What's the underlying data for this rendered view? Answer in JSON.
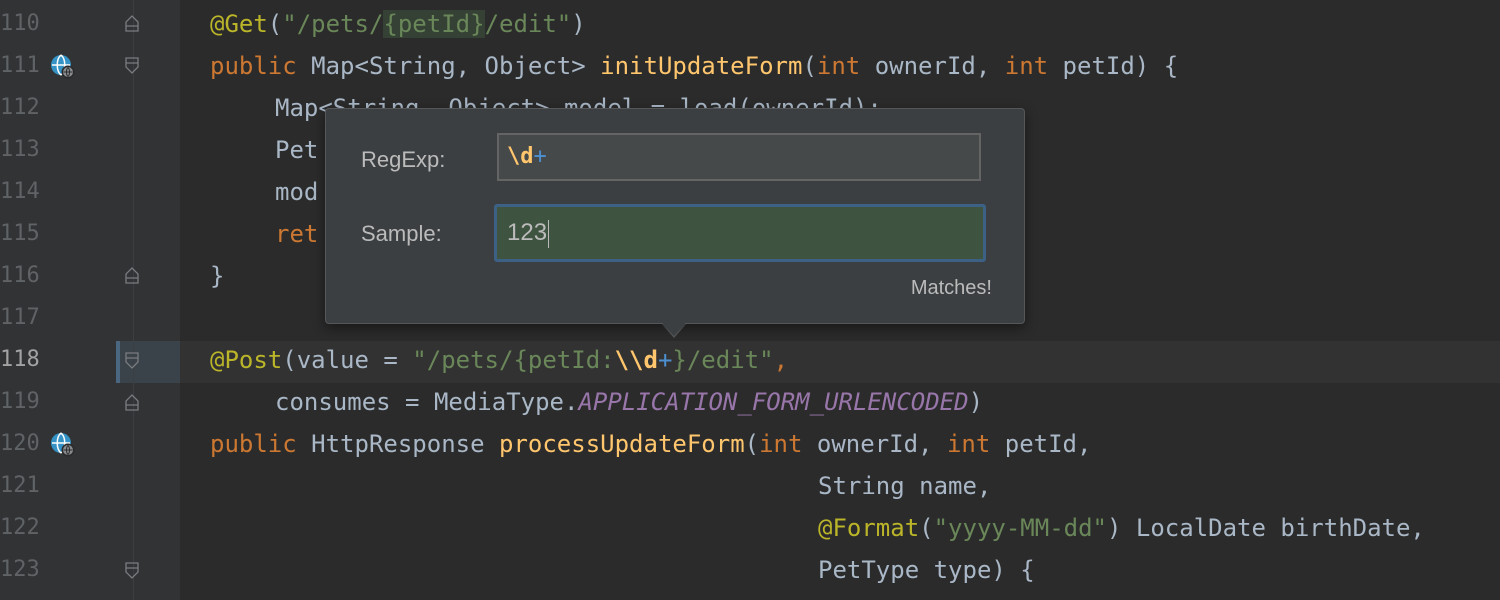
{
  "gutter": {
    "line_numbers": [
      "110",
      "111",
      "112",
      "113",
      "114",
      "115",
      "116",
      "117",
      "118",
      "119",
      "120",
      "121",
      "122",
      "123"
    ],
    "current_line": "118"
  },
  "icons": {
    "fold_marker": "fold-marker-icon",
    "implementation": "globe-implementation-icon"
  },
  "code": {
    "l110": {
      "at": "@Get",
      "p1": "(",
      "s1": "\"/pets/",
      "s2": "{petId}",
      "s3": "/edit\"",
      "p2": ")"
    },
    "l111": {
      "kw1": "public",
      "t1": " Map<String, Object> ",
      "fn": "initUpdateForm",
      "p1": "(",
      "kw2": "int",
      "t2": " ownerId, ",
      "kw3": "int",
      "t3": " petId) {"
    },
    "l112": {
      "t": "Map<String, Object> model = load(ownerId);"
    },
    "l113": {
      "t": "Pet"
    },
    "l114": {
      "t": "mod"
    },
    "l115": {
      "kw": "ret"
    },
    "l116": {
      "t": "}"
    },
    "l118": {
      "at": "@Post",
      "t1": "(value = ",
      "s1": "\"/pets/{petId:",
      "rx1": "\\\\d",
      "rx2": "+",
      "s2": "}/edit\"",
      "t2": ","
    },
    "l119": {
      "t1": "consumes = MediaType.",
      "c": "APPLICATION_FORM_URLENCODED",
      "t2": ")"
    },
    "l120": {
      "kw1": "public",
      "t1": " HttpResponse ",
      "fn": "processUpdateForm",
      "p1": "(",
      "kw2": "int",
      "t2": " ownerId, ",
      "kw3": "int",
      "t3": " petId,"
    },
    "l121": {
      "t": "String name,"
    },
    "l122": {
      "at": "@Format",
      "p1": "(",
      "s": "\"yyyy-MM-dd\"",
      "t": ") LocalDate birthDate,"
    },
    "l123": {
      "t": "PetType type) {"
    }
  },
  "popup": {
    "regexp_label": "RegExp:",
    "regexp_escape": "\\d",
    "regexp_quantifier": "+",
    "sample_label": "Sample:",
    "sample_value": "123",
    "status": "Matches!"
  },
  "colors": {
    "background": "#2b2b2b",
    "keyword": "#cc7832",
    "string": "#6a8759",
    "function": "#ffc66d",
    "annotation": "#bbb529",
    "match_field_bg": "#3f5341",
    "focus_border": "#3d6185"
  }
}
